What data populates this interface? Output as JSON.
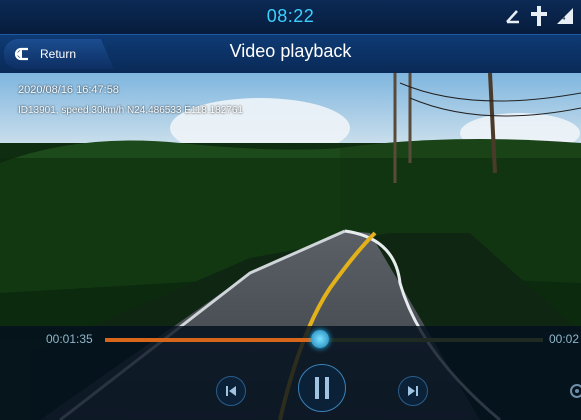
{
  "status_bar": {
    "time": "08:22",
    "icons": [
      "connection-icon",
      "location-pin-icon",
      "signal-icon"
    ],
    "accent_color": "#3ad1ff"
  },
  "header": {
    "return_label": "Return",
    "title": "Video playback"
  },
  "video": {
    "overlay_datetime": "2020/08/16 16:47:58",
    "overlay_info": "ID13901, speed:30km/h N24.486533 E118.182761"
  },
  "playback": {
    "elapsed": "00:01:35",
    "total": "00:02",
    "progress": 0.49,
    "progress_color": "#d8661a",
    "controls": [
      "previous-icon",
      "pause-icon",
      "next-icon",
      "settings-icon"
    ]
  }
}
